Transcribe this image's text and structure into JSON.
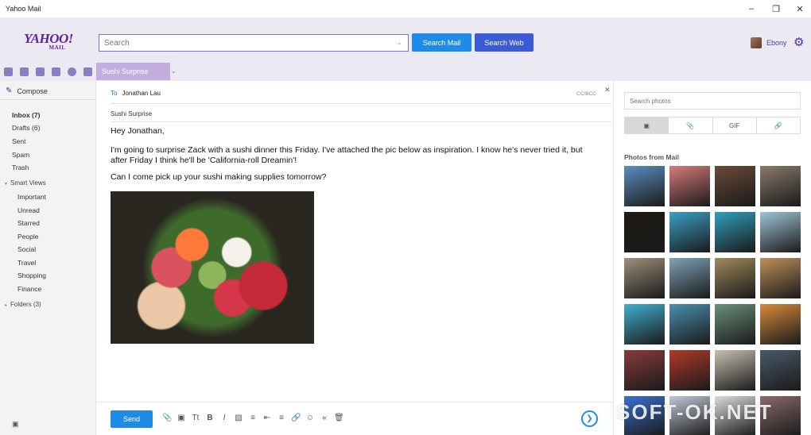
{
  "window": {
    "title": "Yahoo Mail"
  },
  "header": {
    "logo": "YAHOO!",
    "logo_sub": "MAIL",
    "search_placeholder": "Search",
    "search_mail_label": "Search Mail",
    "search_web_label": "Search Web",
    "user_name": "Ebony"
  },
  "tab": {
    "label": "Sushi Surprise"
  },
  "sidebar": {
    "compose_label": "Compose",
    "folders": [
      {
        "label": "Inbox (7)"
      },
      {
        "label": "Drafts (6)"
      },
      {
        "label": "Sent"
      },
      {
        "label": "Spam"
      },
      {
        "label": "Trash"
      }
    ],
    "smart_views_label": "Smart Views",
    "smart_views": [
      {
        "label": "Important"
      },
      {
        "label": "Unread"
      },
      {
        "label": "Starred"
      },
      {
        "label": "People"
      },
      {
        "label": "Social"
      },
      {
        "label": "Travel"
      },
      {
        "label": "Shopping"
      },
      {
        "label": "Finance"
      }
    ],
    "folders_group_label": "Folders (3)"
  },
  "compose": {
    "to_label": "To",
    "to_value": "Jonathan Lau",
    "ccbcc_label": "CC/BCC",
    "subject": "Sushi Surprise",
    "body_lines": [
      "Hey Jonathan,",
      "I'm going to surprise Zack with a sushi dinner this Friday. I've attached the pic below as inspiration. I know he's never tried it, but after Friday I think he'll be 'California-roll Dreamin'!",
      "Can I come pick up your sushi making supplies tomorrow?"
    ],
    "send_label": "Send"
  },
  "photos": {
    "search_placeholder": "Search photos",
    "tab_gif_label": "GIF",
    "section_label": "Photos from Mail",
    "thumbs": [
      "#5b8fc2",
      "#d87a7a",
      "#6a4a38",
      "#8a7a6a",
      "#1e1a14",
      "#3aa0c8",
      "#2f9fbf",
      "#9fc4d8",
      "#9e8f7a",
      "#7ea2b8",
      "#a08a5a",
      "#c0905a",
      "#3fb0d0",
      "#4a8fb0",
      "#6a8f7a",
      "#d88a3a",
      "#8a3a3a",
      "#b03a2a",
      "#c8c0b0",
      "#4a5a6a",
      "#3a6fd0",
      "#c0c8d8",
      "#dcdcdc",
      "#8a6a6a"
    ]
  },
  "watermark": "SOFT-OK.NET"
}
